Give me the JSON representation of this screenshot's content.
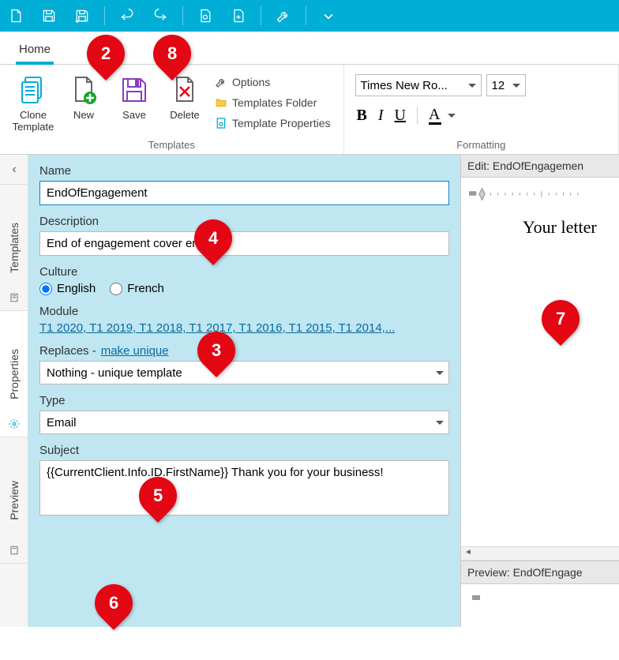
{
  "qa_tooltips": [
    "New File",
    "Save",
    "Save As",
    "Undo",
    "Redo",
    "Edit",
    "Add",
    "Options",
    "More"
  ],
  "tabs": {
    "home": "Home"
  },
  "ribbon": {
    "clone": "Clone Template",
    "new": "New",
    "save": "Save",
    "delete": "Delete",
    "options": "Options",
    "templates_folder": "Templates Folder",
    "template_properties": "Template Properties",
    "group_templates": "Templates",
    "group_formatting": "Formatting",
    "font": "Times New Ro...",
    "size": "12"
  },
  "side": {
    "templates": "Templates",
    "properties": "Properties",
    "preview": "Preview"
  },
  "form": {
    "name_label": "Name",
    "name_value": "EndOfEngagement",
    "description_label": "Description",
    "description_value": "End of engagement cover email",
    "culture_label": "Culture",
    "culture_english": "English",
    "culture_french": "French",
    "module_label": "Module",
    "module_value": "T1 2020, T1 2019, T1 2018, T1 2017, T1 2016, T1 2015, T1 2014,...",
    "replaces_label": "Replaces - ",
    "replaces_link": "make unique",
    "replaces_value": "Nothing - unique template",
    "type_label": "Type",
    "type_value": "Email",
    "subject_label": "Subject",
    "subject_value": "{{CurrentClient.Info.ID.FirstName}} Thank you for your business!"
  },
  "editor": {
    "edit_header": "Edit: EndOfEngagemen",
    "body_text": "Your letter",
    "preview_header": "Preview: EndOfEngage"
  },
  "pins": {
    "p2": "2",
    "p3": "3",
    "p4": "4",
    "p5": "5",
    "p6": "6",
    "p7": "7",
    "p8": "8"
  }
}
